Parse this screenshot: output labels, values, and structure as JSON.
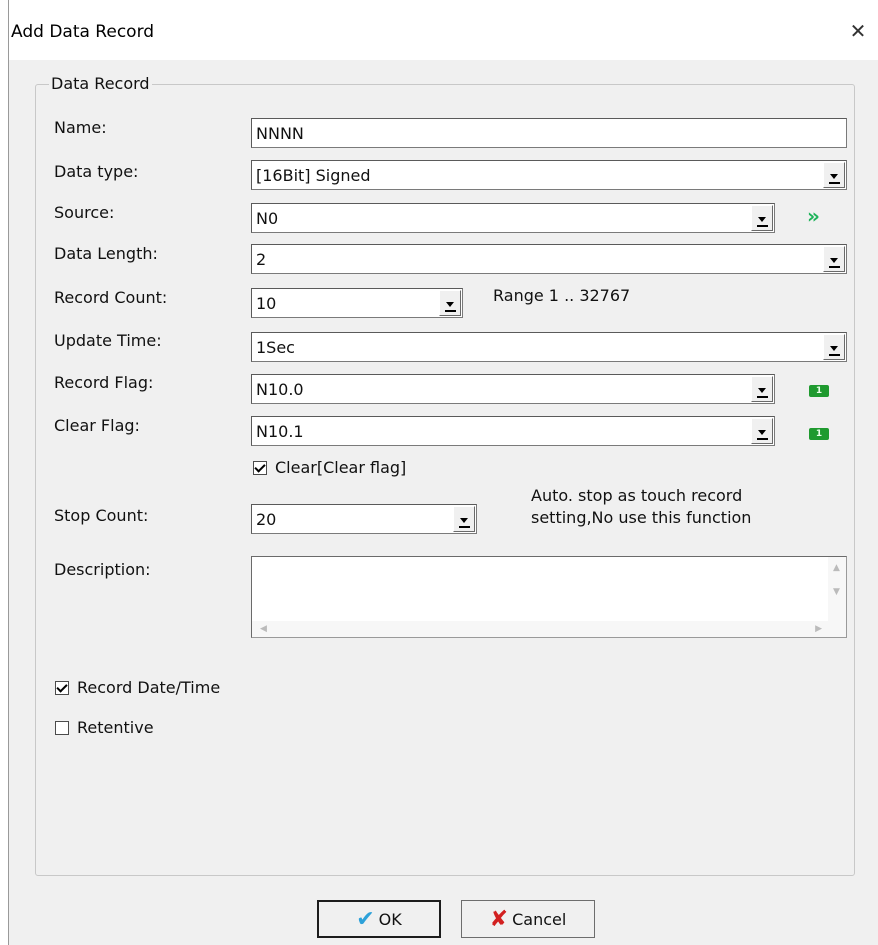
{
  "dialog": {
    "title": "Add Data Record",
    "close_glyph": "✕"
  },
  "group": {
    "legend": "Data Record"
  },
  "fields": {
    "name": {
      "label": "Name:",
      "value": "NNNN"
    },
    "data_type": {
      "label": "Data type:",
      "value": "[16Bit] Signed"
    },
    "source": {
      "label": "Source:",
      "value": "N0",
      "browse_icon": "double-chevron-right-icon",
      "browse_glyph": "»"
    },
    "data_length": {
      "label": "Data Length:",
      "value": "2"
    },
    "record_count": {
      "label": "Record Count:",
      "value": "10",
      "range_text": "Range 1 .. 32767"
    },
    "update_time": {
      "label": "Update Time:",
      "value": "1Sec"
    },
    "record_flag": {
      "label": "Record Flag:",
      "value": "N10.0",
      "flag_icon_text": "1"
    },
    "clear_flag": {
      "label": "Clear Flag:",
      "value": "N10.1",
      "flag_icon_text": "1"
    },
    "clear_checkbox": {
      "label": "Clear[Clear flag]",
      "checked": true
    },
    "stop_count": {
      "label": "Stop Count:",
      "value": "20",
      "hint_line1": "Auto. stop as touch record",
      "hint_line2": "setting,No use this function"
    },
    "description": {
      "label": "Description:",
      "value": ""
    }
  },
  "options": {
    "record_datetime": {
      "label": "Record Date/Time",
      "checked": true
    },
    "retentive": {
      "label": "Retentive",
      "checked": false
    }
  },
  "buttons": {
    "ok": {
      "label": "OK",
      "icon": "checkmark-icon",
      "glyph": "✔"
    },
    "cancel": {
      "label": "Cancel",
      "icon": "x-icon",
      "glyph": "✘"
    }
  },
  "colors": {
    "dialog_bg": "#f0f0f0",
    "titlebar_bg": "#ffffff",
    "accent_green": "#1f9a2f",
    "ok_blue": "#2da1d9",
    "cancel_red": "#d22020"
  }
}
